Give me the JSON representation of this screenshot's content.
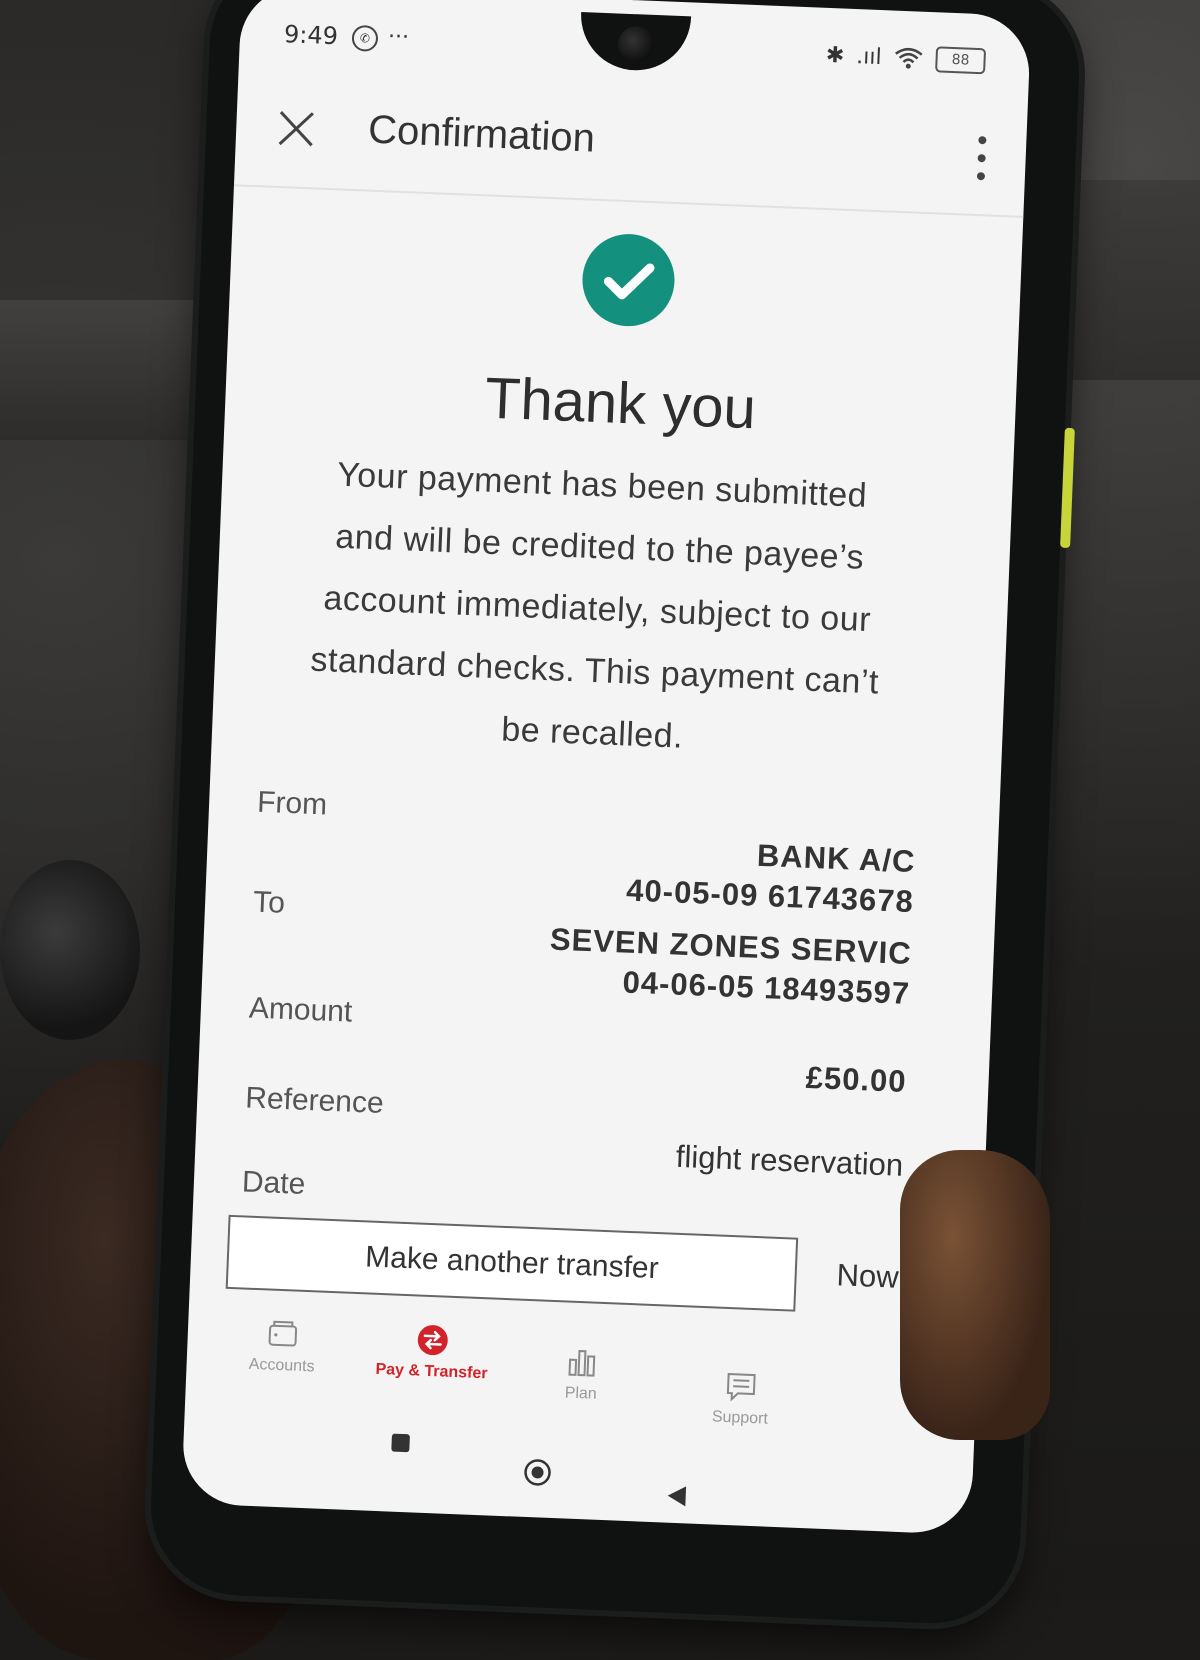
{
  "status_bar": {
    "time": "9:49",
    "whatsapp_glyph": "✆",
    "more": "···",
    "bluetooth_glyph": "✱",
    "signal_glyph": ".ııl",
    "battery": "88"
  },
  "app_bar": {
    "title": "Confirmation",
    "close_icon": "close-icon",
    "menu_icon": "more-vert-icon"
  },
  "success": {
    "icon": "check-circle-icon",
    "color": "#14907f",
    "heading": "Thank you",
    "message_lines": [
      "Your payment has been submitted",
      "and will be credited to the payee’s",
      "account immediately, subject to our",
      "standard checks. This payment can’t",
      "be recalled."
    ]
  },
  "details": {
    "from": {
      "label": "From",
      "name": "BANK A/C",
      "account": "40-05-09 61743678"
    },
    "to": {
      "label": "To",
      "name": "SEVEN ZONES SERVIC",
      "account": "04-06-05 18493597"
    },
    "amount": {
      "label": "Amount",
      "value": "£50.00"
    },
    "reference": {
      "label": "Reference",
      "value": "flight reservation"
    },
    "date": {
      "label": "Date",
      "value": "Now"
    }
  },
  "actions": {
    "make_another_transfer": "Make another transfer"
  },
  "bottom_nav": {
    "accent_color": "#d2232a",
    "items": [
      {
        "label": "Accounts",
        "icon": "wallet-icon",
        "active": false
      },
      {
        "label": "Pay & Transfer",
        "icon": "transfer-icon",
        "active": true
      },
      {
        "label": "Plan",
        "icon": "bar-chart-icon",
        "active": false
      },
      {
        "label": "Support",
        "icon": "chat-icon",
        "active": false
      }
    ]
  },
  "system_nav": {
    "recents_icon": "square-icon",
    "home_icon": "circle-icon",
    "back_icon": "triangle-back-icon"
  }
}
